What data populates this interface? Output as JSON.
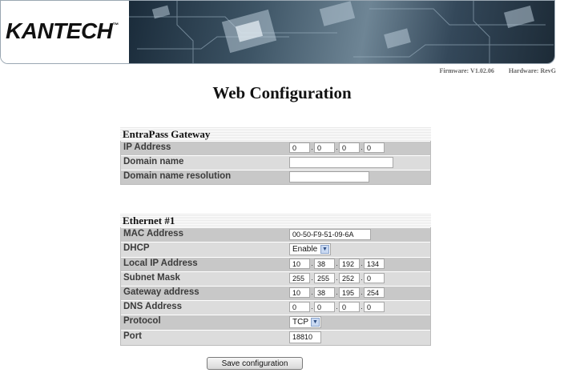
{
  "brand": {
    "logo": "KANTECH",
    "tm": "™"
  },
  "firmware": "Firmware: V1.02.06",
  "hardware": "Hardware: RevG",
  "page_title": "Web Configuration",
  "gateway": {
    "title": "EntraPass Gateway",
    "ip_label": "IP Address",
    "ip": [
      "0",
      "0",
      "0",
      "0"
    ],
    "domain_label": "Domain name",
    "domain_value": "",
    "resolution_label": "Domain name resolution",
    "resolution_value": ""
  },
  "ethernet": {
    "title": "Ethernet #1",
    "mac_label": "MAC Address",
    "mac": "00-50-F9-51-09-6A",
    "dhcp_label": "DHCP",
    "dhcp": "Enable",
    "local_ip_label": "Local IP Address",
    "local_ip": [
      "10",
      "38",
      "192",
      "134"
    ],
    "subnet_label": "Subnet Mask",
    "subnet": [
      "255",
      "255",
      "252",
      "0"
    ],
    "gateway_label": "Gateway address",
    "gateway_ip": [
      "10",
      "38",
      "195",
      "254"
    ],
    "dns_label": "DNS Address",
    "dns": [
      "0",
      "0",
      "0",
      "0"
    ],
    "protocol_label": "Protocol",
    "protocol": "TCP",
    "port_label": "Port",
    "port": "18810"
  },
  "save_label": "Save configuration"
}
